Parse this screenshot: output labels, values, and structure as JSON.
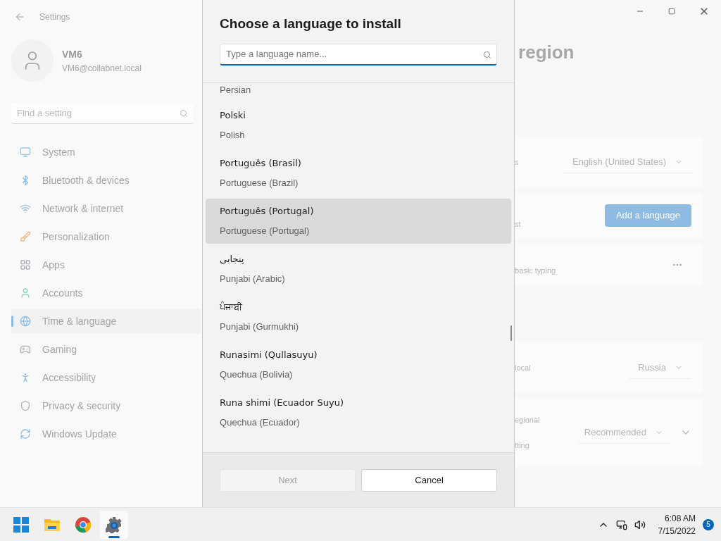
{
  "settings": {
    "title": "Settings",
    "user": {
      "name": "VM6",
      "email": "VM6@collabnet.local"
    },
    "search": {
      "placeholder": "Find a setting"
    },
    "nav": [
      {
        "label": "System",
        "selected": false
      },
      {
        "label": "Bluetooth & devices",
        "selected": false
      },
      {
        "label": "Network & internet",
        "selected": false
      },
      {
        "label": "Personalization",
        "selected": false
      },
      {
        "label": "Apps",
        "selected": false
      },
      {
        "label": "Accounts",
        "selected": false
      },
      {
        "label": "Time & language",
        "selected": true
      },
      {
        "label": "Gaming",
        "selected": false
      },
      {
        "label": "Accessibility",
        "selected": false
      },
      {
        "label": "Privacy & security",
        "selected": false
      },
      {
        "label": "Windows Update",
        "selected": false
      }
    ]
  },
  "page": {
    "title": "region",
    "cards": [
      {
        "kind": "dropdown",
        "label": "s",
        "value": "English (United States)"
      },
      {
        "kind": "button",
        "label": "st",
        "button": "Add a language"
      },
      {
        "kind": "more",
        "label": "basic typing"
      },
      {
        "kind": "gap"
      },
      {
        "kind": "dropdown",
        "label": "local",
        "value": "Russia"
      },
      {
        "kind": "dropdown_expand",
        "label": "egional",
        "label2": "tting",
        "value": "Recommended"
      }
    ]
  },
  "dialog": {
    "title": "Choose a language to install",
    "search": {
      "placeholder": "Type a language name..."
    },
    "languages": [
      {
        "english": "Persian",
        "selected": false
      },
      {
        "native": "Polski",
        "english": "Polish",
        "selected": false
      },
      {
        "native": "Português (Brasil)",
        "english": "Portuguese (Brazil)",
        "selected": false
      },
      {
        "native": "Português (Portugal)",
        "english": "Portuguese (Portugal)",
        "selected": true
      },
      {
        "native": "پنجابی",
        "english": "Punjabi (Arabic)",
        "selected": false
      },
      {
        "native": "ਪੰਜਾਬੀ",
        "english": "Punjabi (Gurmukhi)",
        "selected": false
      },
      {
        "native": "Runasimi (Qullasuyu)",
        "english": "Quechua (Bolivia)",
        "selected": false
      },
      {
        "native": "Runa shimi (Ecuador Suyu)",
        "english": "Quechua (Ecuador)",
        "selected": false
      }
    ],
    "buttons": [
      {
        "label": "Next",
        "disabled": true
      },
      {
        "label": "Cancel",
        "disabled": false
      }
    ]
  },
  "taskbar": {
    "apps": [
      {
        "kind": "start",
        "active": false
      },
      {
        "kind": "explorer",
        "active": false
      },
      {
        "kind": "chrome",
        "active": false
      },
      {
        "kind": "settings",
        "active": true
      }
    ],
    "time": "6:08 AM",
    "date": "7/15/2022",
    "notifications": "5"
  }
}
